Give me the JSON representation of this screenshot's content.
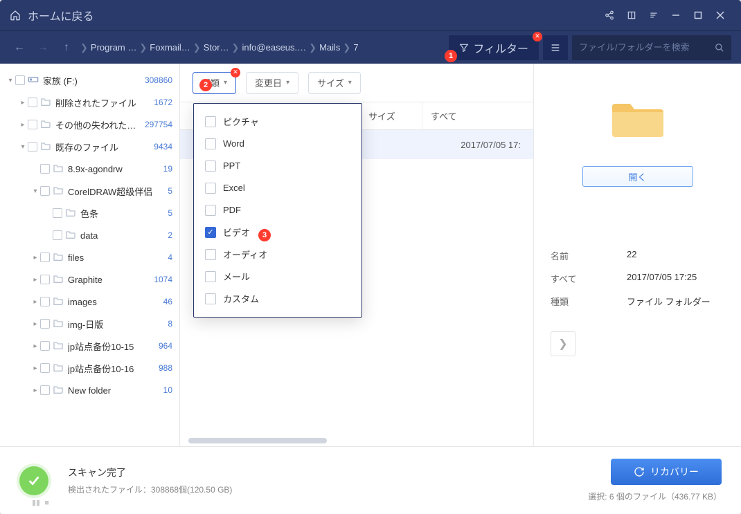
{
  "header": {
    "home": "ホームに戻る"
  },
  "breadcrumb": [
    "Program …",
    "Foxmail…",
    "Stor…",
    "info@easeus.…",
    "Mails",
    "7"
  ],
  "filter_label": "フィルター",
  "search_placeholder": "ファイル/フォルダーを検索",
  "chips": {
    "type": "種類",
    "date": "変更日",
    "size": "サイズ"
  },
  "type_options": [
    {
      "label": "ピクチャ",
      "checked": false
    },
    {
      "label": "Word",
      "checked": false
    },
    {
      "label": "PPT",
      "checked": false
    },
    {
      "label": "Excel",
      "checked": false
    },
    {
      "label": "PDF",
      "checked": false
    },
    {
      "label": "ビデオ",
      "checked": true
    },
    {
      "label": "オーディオ",
      "checked": false
    },
    {
      "label": "メール",
      "checked": false
    },
    {
      "label": "カスタム",
      "checked": false
    }
  ],
  "columns": {
    "size": "サイズ",
    "date": "すべて"
  },
  "tree": [
    {
      "pad": 0,
      "tw": "▾",
      "label": "家族 (F:)",
      "count": "308860",
      "drive": true
    },
    {
      "pad": 1,
      "tw": "▸",
      "label": "削除されたファイル",
      "count": "1672"
    },
    {
      "pad": 1,
      "tw": "▸",
      "label": "その他の失われたフ…",
      "count": "297754"
    },
    {
      "pad": 1,
      "tw": "▾",
      "label": "既存のファイル",
      "count": "9434"
    },
    {
      "pad": 2,
      "tw": "",
      "label": "8.9x-agondrw",
      "count": "19"
    },
    {
      "pad": 2,
      "tw": "▾",
      "label": "CorelDRAW超级伴侣",
      "count": "5"
    },
    {
      "pad": 3,
      "tw": "",
      "label": "色条",
      "count": "5"
    },
    {
      "pad": 3,
      "tw": "",
      "label": "data",
      "count": "2"
    },
    {
      "pad": 2,
      "tw": "▸",
      "label": "files",
      "count": "4"
    },
    {
      "pad": 2,
      "tw": "▸",
      "label": "Graphite",
      "count": "1074"
    },
    {
      "pad": 2,
      "tw": "▸",
      "label": "images",
      "count": "46"
    },
    {
      "pad": 2,
      "tw": "▸",
      "label": "img-日版",
      "count": "8"
    },
    {
      "pad": 2,
      "tw": "▸",
      "label": "jp站点备份10-15",
      "count": "964"
    },
    {
      "pad": 2,
      "tw": "▸",
      "label": "jp站点备份10-16",
      "count": "988"
    },
    {
      "pad": 2,
      "tw": "▸",
      "label": "New folder",
      "count": "10"
    }
  ],
  "row_date": "2017/07/05 17:",
  "preview": {
    "open": "開く",
    "k_name": "名前",
    "v_name": "22",
    "k_date": "すべて",
    "v_date": "2017/07/05 17:25",
    "k_type": "種類",
    "v_type": "ファイル フォルダー"
  },
  "footer": {
    "done": "スキャン完了",
    "detected": "検出されたファイル：308868個(120.50 GB)",
    "recover": "リカバリー",
    "selection": "選択: 6 個のファイル（436.77 KB）"
  },
  "badges": {
    "b1": "1",
    "b2": "2",
    "b3": "3"
  }
}
